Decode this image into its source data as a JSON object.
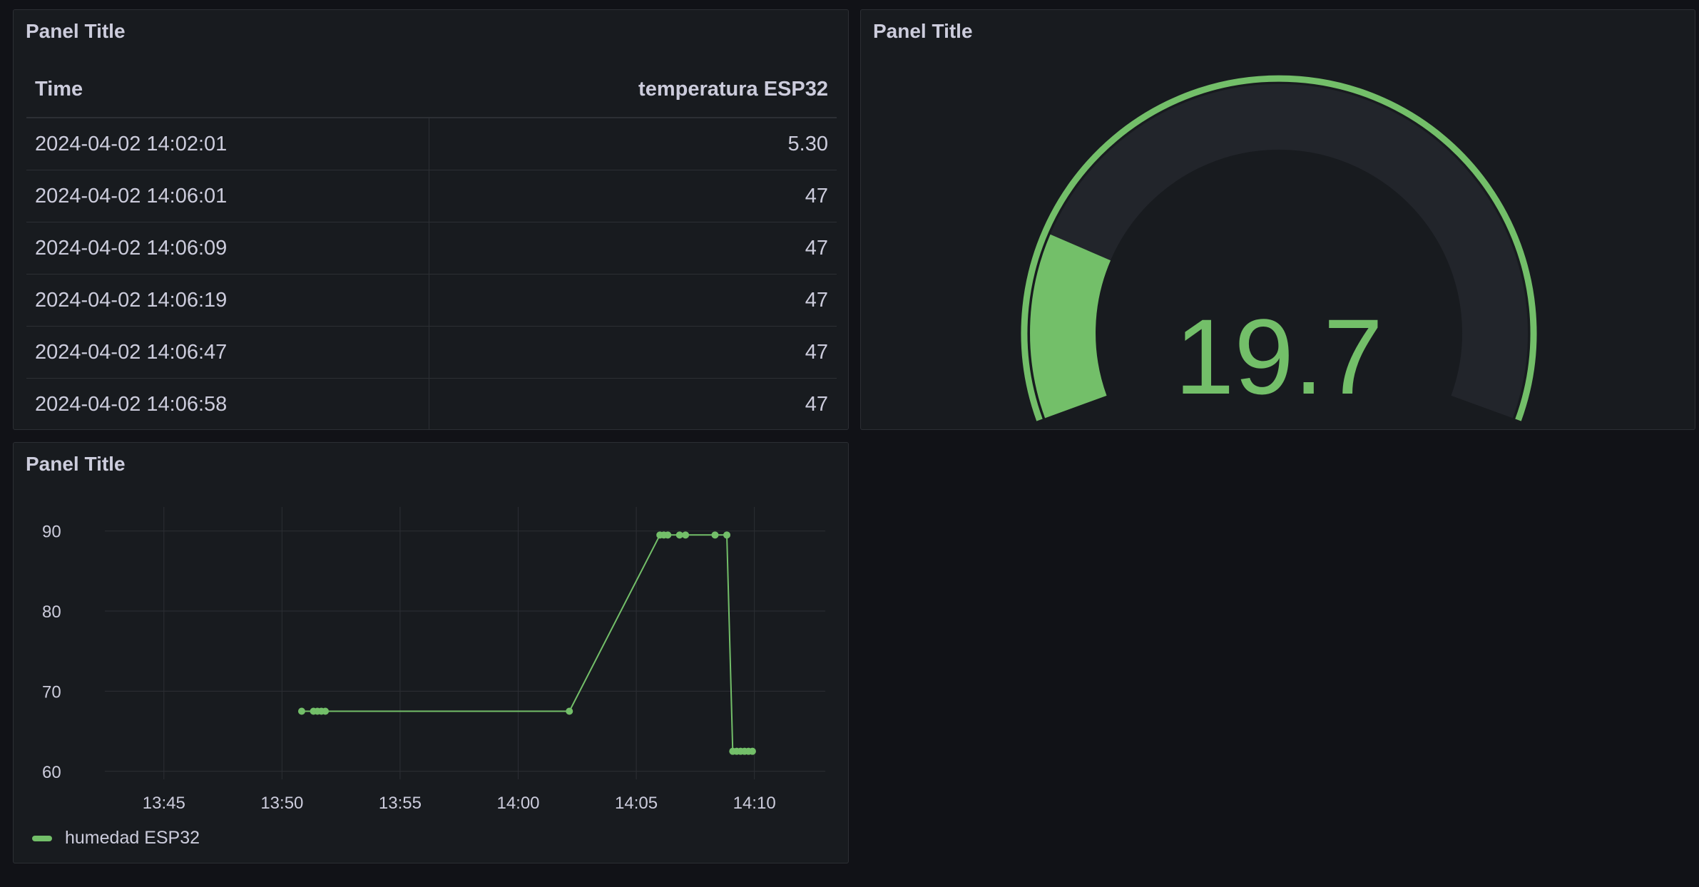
{
  "colors": {
    "accent": "#73bf69",
    "panel_bg": "#181b1f",
    "page_bg": "#111217",
    "grid": "#2c2f34",
    "text": "#ccccdc",
    "gauge_track": "#22252b"
  },
  "table_panel": {
    "title": "Panel Title",
    "columns": [
      "Time",
      "temperatura ESP32"
    ],
    "rows": [
      [
        "2024-04-02 14:02:01",
        "5.30"
      ],
      [
        "2024-04-02 14:06:01",
        "47"
      ],
      [
        "2024-04-02 14:06:09",
        "47"
      ],
      [
        "2024-04-02 14:06:19",
        "47"
      ],
      [
        "2024-04-02 14:06:47",
        "47"
      ],
      [
        "2024-04-02 14:06:58",
        "47"
      ]
    ]
  },
  "gauge_panel": {
    "title": "Panel Title",
    "value": "19.7",
    "fill_fraction": 0.197
  },
  "chart_panel": {
    "title": "Panel Title",
    "legend": "humedad ESP32"
  },
  "chart_data": {
    "type": "line",
    "x_ticks": [
      "13:45",
      "13:50",
      "13:55",
      "14:00",
      "14:05",
      "14:10"
    ],
    "y_ticks": [
      60,
      70,
      80,
      90
    ],
    "xlim": [
      "13:42:30",
      "14:13:00"
    ],
    "ylim": [
      59,
      93
    ],
    "grid": true,
    "legend_position": "bottom-left",
    "series": [
      {
        "name": "humedad ESP32",
        "points": [
          [
            "13:50:50",
            67.5
          ],
          [
            "13:51:20",
            67.5
          ],
          [
            "13:51:30",
            67.5
          ],
          [
            "13:51:40",
            67.5
          ],
          [
            "13:51:50",
            67.5
          ],
          [
            "14:02:10",
            67.5
          ],
          [
            "14:06:00",
            89.5
          ],
          [
            "14:06:10",
            89.5
          ],
          [
            "14:06:20",
            89.5
          ],
          [
            "14:06:50",
            89.5
          ],
          [
            "14:07:05",
            89.5
          ],
          [
            "14:08:20",
            89.5
          ],
          [
            "14:08:50",
            89.5
          ],
          [
            "14:09:05",
            62.5
          ],
          [
            "14:09:15",
            62.5
          ],
          [
            "14:09:25",
            62.5
          ],
          [
            "14:09:35",
            62.5
          ],
          [
            "14:09:45",
            62.5
          ],
          [
            "14:09:55",
            62.5
          ]
        ]
      }
    ]
  }
}
